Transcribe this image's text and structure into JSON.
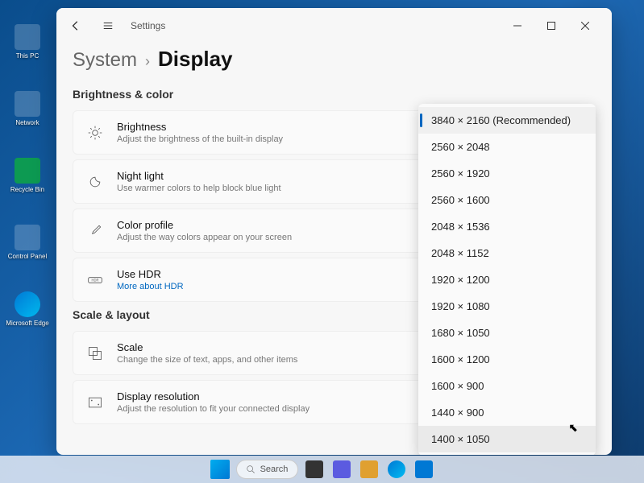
{
  "desktop": {
    "icons": [
      {
        "label": "This PC"
      },
      {
        "label": "Network"
      },
      {
        "label": "Recycle Bin"
      },
      {
        "label": "Control Panel"
      },
      {
        "label": "Microsoft Edge"
      }
    ]
  },
  "window": {
    "app_title": "Settings",
    "breadcrumb": {
      "parent": "System",
      "current": "Display"
    }
  },
  "sections": {
    "brightness_color_title": "Brightness & color",
    "scale_layout_title": "Scale & layout"
  },
  "settings": {
    "brightness": {
      "label": "Brightness",
      "desc": "Adjust the brightness of the built-in display"
    },
    "night_light": {
      "label": "Night light",
      "desc": "Use warmer colors to help block blue light"
    },
    "color_profile": {
      "label": "Color profile",
      "desc": "Adjust the way colors appear on your screen"
    },
    "hdr": {
      "label": "Use HDR",
      "link": "More about HDR"
    },
    "scale": {
      "label": "Scale",
      "desc": "Change the size of text, apps, and other items"
    },
    "resolution": {
      "label": "Display resolution",
      "desc": "Adjust the resolution to fit your connected display"
    }
  },
  "resolution_dropdown": {
    "selected_index": 0,
    "hover_index": 12,
    "options": [
      "3840 × 2160 (Recommended)",
      "2560 × 2048",
      "2560 × 1920",
      "2560 × 1600",
      "2048 × 1536",
      "2048 × 1152",
      "1920 × 1200",
      "1920 × 1080",
      "1680 × 1050",
      "1600 × 1200",
      "1600 × 900",
      "1440 × 900",
      "1400 × 1050"
    ]
  },
  "taskbar": {
    "search_placeholder": "Search"
  }
}
